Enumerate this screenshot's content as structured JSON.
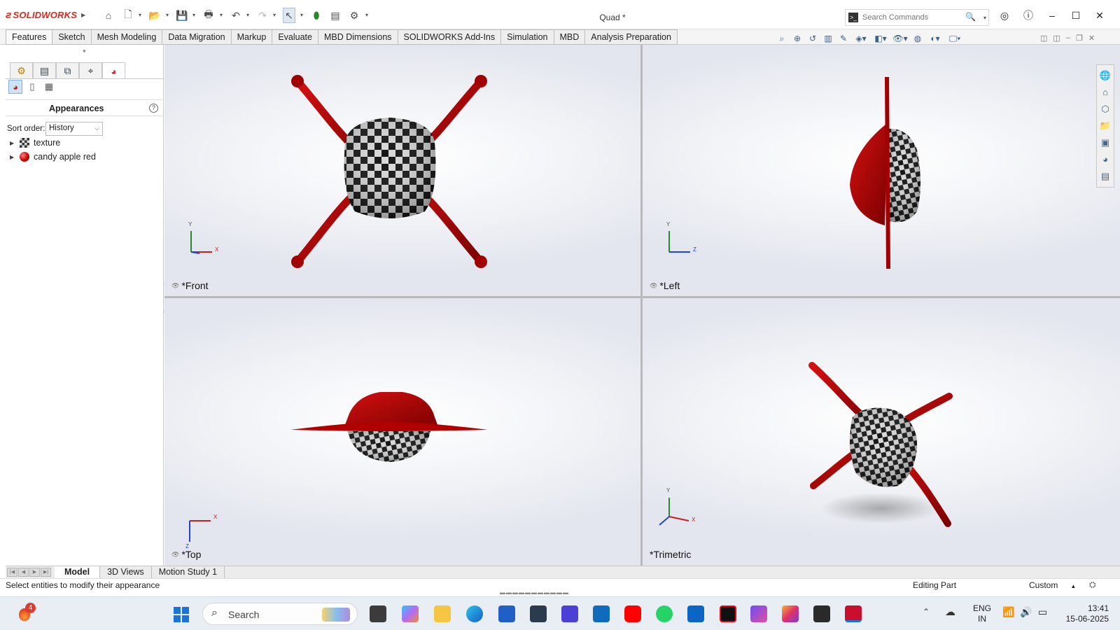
{
  "app": {
    "brand": "SOLIDWORKS",
    "document_title": "Quad *",
    "search_placeholder": "Search Commands"
  },
  "command_tabs": [
    "Features",
    "Sketch",
    "Mesh Modeling",
    "Data Migration",
    "Markup",
    "Evaluate",
    "MBD Dimensions",
    "SOLIDWORKS Add-Ins",
    "Simulation",
    "MBD",
    "Analysis Preparation"
  ],
  "appearance_pane": {
    "title": "Appearances",
    "sort_label": "Sort order:",
    "sort_value": "History",
    "items": [
      {
        "label": "texture",
        "icon": "texture-icon"
      },
      {
        "label": "candy apple red",
        "icon": "red-sphere-icon"
      }
    ]
  },
  "viewports": {
    "front": {
      "label": "*Front",
      "axes": [
        "Y",
        "X"
      ]
    },
    "left": {
      "label": "*Left",
      "axes": [
        "Y",
        "Z"
      ]
    },
    "top": {
      "label": "*Top",
      "axes": [
        "X",
        "Z"
      ]
    },
    "trimetric": {
      "label": "*Trimetric",
      "axes": [
        "Y",
        "X"
      ]
    }
  },
  "model_tabs": [
    "Model",
    "3D Views",
    "Motion Study 1"
  ],
  "status": {
    "message": "Select entities to modify their appearance",
    "mode": "Editing Part",
    "units": "Custom"
  },
  "taskbar": {
    "notification_count": "4",
    "search_label": "Search",
    "lang_line1": "ENG",
    "lang_line2": "IN",
    "time": "13:41",
    "date": "15-06-2025"
  },
  "colors": {
    "model_red": "#b00000",
    "accent_blue": "#1a73d9",
    "solidworks_red": "#d52b1e"
  }
}
